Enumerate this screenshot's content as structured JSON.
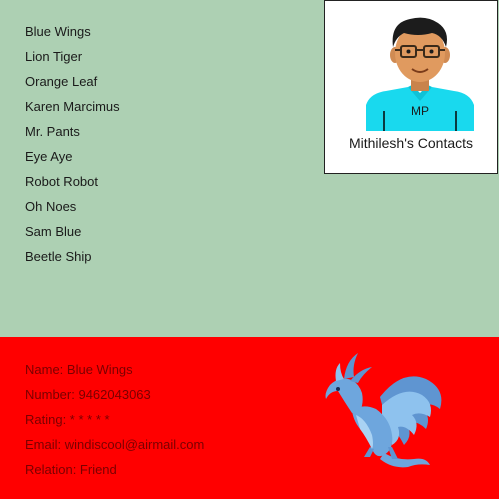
{
  "contacts": [
    "Blue Wings",
    "Lion Tiger",
    "Orange Leaf",
    "Karen Marcimus",
    "Mr. Pants",
    "Eye Aye",
    "Robot Robot",
    "Oh Noes",
    "Sam Blue",
    "Beetle Ship"
  ],
  "card": {
    "initials": "MP",
    "title": "Mithilesh's Contacts"
  },
  "details": {
    "name": "Name: Blue Wings",
    "number": "Number: 9462043063",
    "rating": "Rating: * * * * *",
    "email": "Email: windiscool@airmail.com",
    "relation": "Relation: Friend"
  },
  "colors": {
    "top_bg": "#add0b3",
    "bottom_bg": "#ff0000",
    "detail_text": "#7a0000",
    "avatar_shirt": "#19d9ee",
    "dragon": "#6ea6dd"
  },
  "icons": {
    "avatar": "avatar-icon",
    "dragon": "winged-dragon-icon"
  }
}
